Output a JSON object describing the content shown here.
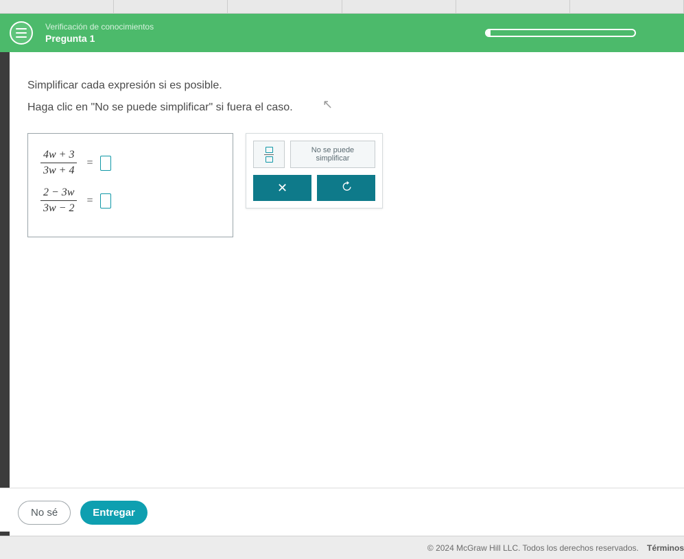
{
  "header": {
    "subtitle": "Verificación de conocimientos",
    "title": "Pregunta 1"
  },
  "instructions": {
    "line1": "Simplificar cada expresión si es posible.",
    "line2": "Haga clic en \"No se puede simplificar\" si fuera el caso."
  },
  "expressions": [
    {
      "numerator": "4w + 3",
      "denominator": "3w + 4"
    },
    {
      "numerator": "2 − 3w",
      "denominator": "3w − 2"
    }
  ],
  "toolbox": {
    "cannot_simplify_label": "No se puede simplificar"
  },
  "buttons": {
    "dont_know": "No sé",
    "submit": "Entregar"
  },
  "footer": {
    "copyright": "© 2024 McGraw Hill LLC. Todos los derechos reservados.",
    "terms": "Términos"
  }
}
